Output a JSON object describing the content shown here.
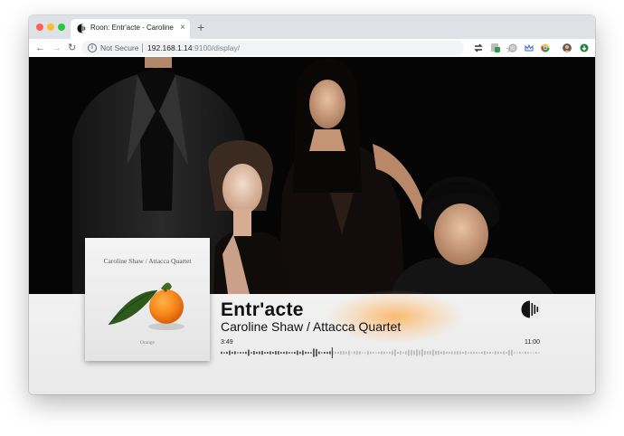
{
  "browser": {
    "tab_title": "Roon: Entr'acte - Caroline Shaw",
    "tab_close": "×",
    "new_tab": "+",
    "security_label": "Not Secure",
    "url_host": "192.168.1.14",
    "url_rest": ":9100/display/",
    "nav": {
      "back": "←",
      "forward": "→",
      "reload": "↻"
    },
    "bookmark_star": "☆",
    "extension_icons": [
      "sync-icon",
      "extension-badge-icon",
      "circle-icon",
      "crown-icon",
      "chrome-icon",
      "profile-avatar-icon",
      "update-icon"
    ]
  },
  "now_playing": {
    "album_art": {
      "title": "Caroline Shaw / Attacca Quartet",
      "subtitle": "Orange"
    },
    "track_title": "Entr'acte",
    "artist": "Caroline Shaw / Attacca Quartet",
    "time_elapsed": "3:49",
    "time_total": "11:00",
    "progress": 0.347
  },
  "colors": {
    "hero_background": "#050505",
    "panel_background": "#ececec",
    "glow_accent": "#ffa846",
    "waveform_played": "#555555",
    "waveform_remaining": "#bbbbbb"
  }
}
